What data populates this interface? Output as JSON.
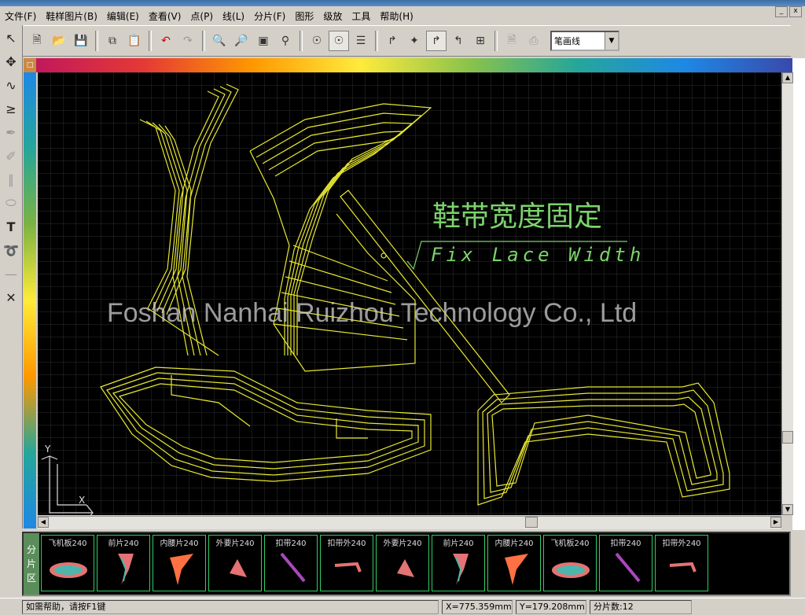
{
  "menu": [
    "文件(F)",
    "鞋样图片(B)",
    "编辑(E)",
    "查看(V)",
    "点(P)",
    "线(L)",
    "分片(F)",
    "图形",
    "级放",
    "工具",
    "帮助(H)"
  ],
  "toolbar": {
    "line_mode": "笔画线"
  },
  "canvas": {
    "annotation_cn": "鞋带宽度固定",
    "annotation_en": "Fix Lace Width",
    "watermark": "Foshan Nanhai Ruizhou Technology Co., Ltd",
    "axis_y": "Y",
    "axis_x": "X"
  },
  "piece_panel": {
    "label": [
      "分",
      "片",
      "区"
    ],
    "pieces": [
      {
        "name": "飞机板240",
        "icon": "sole-icon"
      },
      {
        "name": "前片240",
        "icon": "front-piece-icon"
      },
      {
        "name": "内腰片240",
        "icon": "inner-quarter-icon"
      },
      {
        "name": "外要片240",
        "icon": "outer-quarter-icon"
      },
      {
        "name": "扣带240",
        "icon": "strap-icon"
      },
      {
        "name": "扣带外240",
        "icon": "strap-outer-icon"
      },
      {
        "name": "外要片240",
        "icon": "outer-quarter-icon"
      },
      {
        "name": "前片240",
        "icon": "front-piece-icon"
      },
      {
        "name": "内腰片240",
        "icon": "inner-quarter-icon"
      },
      {
        "name": "飞机板240",
        "icon": "sole-icon"
      },
      {
        "name": "扣带240",
        "icon": "strap-icon"
      },
      {
        "name": "扣带外240",
        "icon": "strap-outer-icon"
      }
    ]
  },
  "status": {
    "help": "如需帮助，请按F1键",
    "x": "X=775.359mm",
    "y": "Y=179.208mm",
    "count": "分片数:12"
  }
}
